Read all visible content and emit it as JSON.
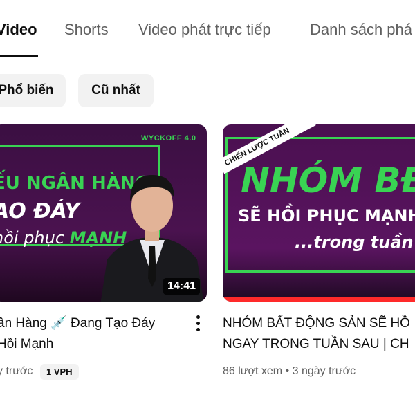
{
  "tabs": [
    {
      "label": "Video",
      "active": true
    },
    {
      "label": "Shorts",
      "active": false
    },
    {
      "label": "Video phát trực tiếp",
      "active": false
    },
    {
      "label": "Danh sách phá",
      "active": false
    }
  ],
  "chips": [
    "Phổ biến",
    "Cũ nhất"
  ],
  "videos": [
    {
      "thumb_badge": "WYCKOFF 4.0",
      "thumb_line1": "ẾU NGÂN HÀNG",
      "thumb_line2": "AO ĐÁY",
      "thumb_line3_a": "hồi phục ",
      "thumb_line3_b": "MẠNH",
      "duration": "14:41",
      "title_line1": "ân Hàng 💉  Đang Tạo Đáy",
      "title_line2": "Hồi Mạnh",
      "meta": "y trước",
      "badge": "1 VPH"
    },
    {
      "thumb_ribbon": "CHIẾN LƯỢC TUẦN",
      "thumb_line1": "NHÓM BĐS",
      "thumb_line2": "SẼ HỒI PHỤC MẠNH",
      "thumb_line3": "...trong tuần sa",
      "title_line1": "NHÓM BẤT ĐỘNG SẢN SẼ HỒ",
      "title_line2": "NGAY TRONG TUẦN SAU | CH",
      "meta": "86 lượt xem • 3 ngày trước"
    }
  ],
  "colors": {
    "accent_green": "#39d353",
    "thumb_purple": "#4a124f",
    "progress_red": "#ff2a2a"
  },
  "icons": {
    "more": "more-vert-icon"
  }
}
